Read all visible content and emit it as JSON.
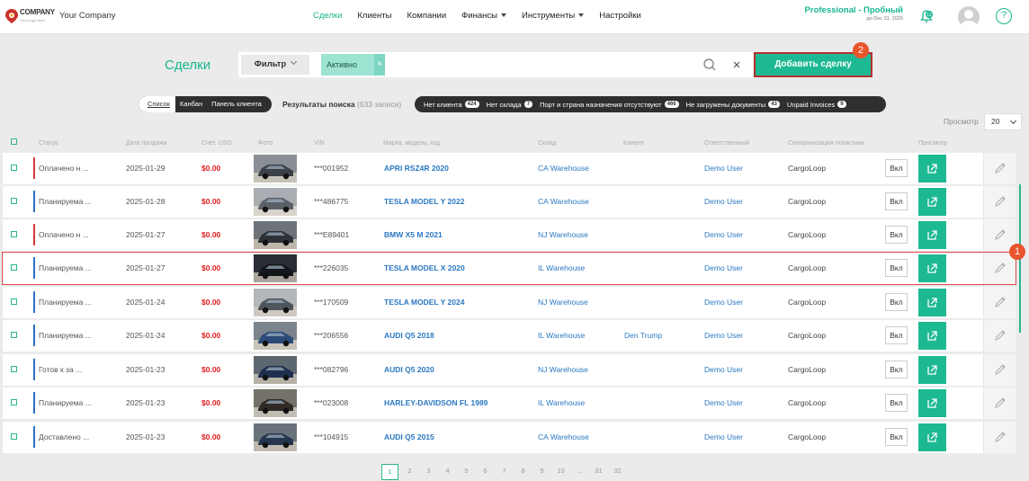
{
  "header": {
    "logo_main": "COMPANY",
    "logo_sub": "Your Logo Here",
    "company_name": "Your Company",
    "nav": [
      {
        "label": "Сделки",
        "active": true,
        "dropdown": false
      },
      {
        "label": "Клиенты",
        "active": false,
        "dropdown": false
      },
      {
        "label": "Компании",
        "active": false,
        "dropdown": false
      },
      {
        "label": "Финансы",
        "active": false,
        "dropdown": true
      },
      {
        "label": "Инструменты",
        "active": false,
        "dropdown": true
      },
      {
        "label": "Настройки",
        "active": false,
        "dropdown": false
      }
    ],
    "plan_name": "Professional - Пробный",
    "plan_date": "до Dec 31, 2025",
    "notifications_count": "12",
    "help_label": "?"
  },
  "toolbar": {
    "title": "Сделки",
    "filter_label": "Фильтр",
    "active_tag": "Активно",
    "tag_close": "×",
    "add_button_label": "Добавить сделку"
  },
  "callouts": {
    "row_marker": "1",
    "button_marker": "2"
  },
  "view_tabs": [
    "Список",
    "Канбан",
    "Панель клиента"
  ],
  "results": {
    "label": "Результаты поиска",
    "count": "(633 записи)"
  },
  "chips": [
    {
      "label": "Нет клиента",
      "count": "424"
    },
    {
      "label": "Нет склада",
      "count": "7"
    },
    {
      "label": "Порт и страна назначения отсутствуют",
      "count": "466"
    },
    {
      "label": "Не загружены документы",
      "count": "43"
    },
    {
      "label": "Unpaid Invoices",
      "count": "9"
    }
  ],
  "per_page": {
    "label": "Просмотр",
    "value": "20"
  },
  "columns": [
    "Статус",
    "Дата продажи",
    "Счет, USD",
    "Фото",
    "VIN",
    "Марка, модель, год",
    "Склад",
    "Клиент",
    "Ответственный",
    "Синхронизация логистики",
    "Просмотр"
  ],
  "rows": [
    {
      "status": "Оплачено н ...",
      "status_color": "#d63b3b",
      "date": "2025-01-29",
      "amount": "$0.00",
      "vin": "***001952",
      "model": "APRI RSZ4R 2020",
      "warehouse": "CA Warehouse",
      "client": "",
      "responsible": "Demo User",
      "sync": "CargoLoop",
      "toggle": "Вкл",
      "selected": false
    },
    {
      "status": "Планируема ...",
      "status_color": "#2b6fc2",
      "date": "2025-01-28",
      "amount": "$0.00",
      "vin": "***486775",
      "model": "TESLA MODEL Y 2022",
      "warehouse": "CA Warehouse",
      "client": "",
      "responsible": "Demo User",
      "sync": "CargoLoop",
      "toggle": "Вкл",
      "selected": false
    },
    {
      "status": "Оплачено н ...",
      "status_color": "#d63b3b",
      "date": "2025-01-27",
      "amount": "$0.00",
      "vin": "***E89401",
      "model": "BMW X5 M 2021",
      "warehouse": "NJ Warehouse",
      "client": "",
      "responsible": "Demo User",
      "sync": "CargoLoop",
      "toggle": "Вкл",
      "selected": false
    },
    {
      "status": "Планируема ...",
      "status_color": "#2b6fc2",
      "date": "2025-01-27",
      "amount": "$0.00",
      "vin": "***226035",
      "model": "TESLA MODEL X 2020",
      "warehouse": "IL Warehouse",
      "client": "",
      "responsible": "Demo User",
      "sync": "CargoLoop",
      "toggle": "Вкл",
      "selected": true
    },
    {
      "status": "Планируема ...",
      "status_color": "#2b6fc2",
      "date": "2025-01-24",
      "amount": "$0.00",
      "vin": "***170509",
      "model": "TESLA MODEL Y 2024",
      "warehouse": "NJ Warehouse",
      "client": "",
      "responsible": "Demo User",
      "sync": "CargoLoop",
      "toggle": "Вкл",
      "selected": false
    },
    {
      "status": "Планируема ...",
      "status_color": "#2b6fc2",
      "date": "2025-01-24",
      "amount": "$0.00",
      "vin": "***206556",
      "model": "AUDI Q5 2018",
      "warehouse": "IL Warehouse",
      "client": "Den Trump",
      "responsible": "Demo User",
      "sync": "CargoLoop",
      "toggle": "Вкл",
      "selected": false
    },
    {
      "status": "Готов к за ...",
      "status_color": "#2b6fc2",
      "date": "2025-01-23",
      "amount": "$0.00",
      "vin": "***082796",
      "model": "AUDI Q5 2020",
      "warehouse": "NJ Warehouse",
      "client": "",
      "responsible": "Demo User",
      "sync": "CargoLoop",
      "toggle": "Вкл",
      "selected": false
    },
    {
      "status": "Планируема ...",
      "status_color": "#2b6fc2",
      "date": "2025-01-23",
      "amount": "$0.00",
      "vin": "***023008",
      "model": "HARLEY-DAVIDSON FL 1989",
      "warehouse": "IL Warehouse",
      "client": "",
      "responsible": "Demo User",
      "sync": "CargoLoop",
      "toggle": "Вкл",
      "selected": false
    },
    {
      "status": "Доставлено ...",
      "status_color": "#2b6fc2",
      "date": "2025-01-23",
      "amount": "$0.00",
      "vin": "***104915",
      "model": "AUDI Q5 2015",
      "warehouse": "CA Warehouse",
      "client": "",
      "responsible": "Demo User",
      "sync": "CargoLoop",
      "toggle": "Вкл",
      "selected": false
    }
  ],
  "pagination": [
    "1",
    "2",
    "3",
    "4",
    "5",
    "6",
    "7",
    "8",
    "9",
    "10",
    "...",
    "31",
    "32"
  ],
  "colors": {
    "accent": "#1db992",
    "link": "#2b78c2",
    "amount": "#e11d1d",
    "highlight": "#e04747",
    "callout": "#e8542b"
  }
}
